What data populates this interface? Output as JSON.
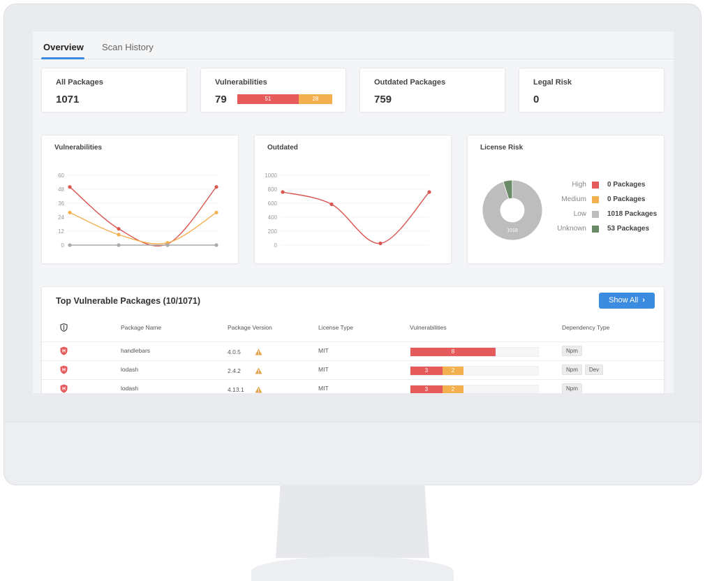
{
  "tabs": [
    {
      "label": "Overview",
      "active": true
    },
    {
      "label": "Scan History",
      "active": false
    }
  ],
  "stats": {
    "all_packages": {
      "label": "All Packages",
      "value": "1071"
    },
    "vulnerabilities": {
      "label": "Vulnerabilities",
      "value": "79",
      "high": 51,
      "medium": 28
    },
    "outdated": {
      "label": "Outdated Packages",
      "value": "759"
    },
    "legal_risk": {
      "label": "Legal Risk",
      "value": "0"
    }
  },
  "colors": {
    "high": "#e55a5a",
    "medium": "#f4b04f",
    "low": "#bdbdbd",
    "unknown": "#6b8a67",
    "accent": "#3b8be0"
  },
  "chart_data": [
    {
      "type": "line",
      "title": "Vulnerabilities",
      "ylim": [
        0,
        60
      ],
      "yticks": [
        0,
        12,
        24,
        36,
        48,
        60
      ],
      "x": [
        0,
        1,
        2,
        3
      ],
      "series": [
        {
          "color": "#d9554f",
          "values": [
            50,
            14,
            1,
            50
          ]
        },
        {
          "color": "#f4b04f",
          "values": [
            28,
            9,
            2,
            28
          ]
        },
        {
          "color": "#aaaaaa",
          "values": [
            0,
            0,
            0,
            0
          ]
        }
      ]
    },
    {
      "type": "line",
      "title": "Outdated",
      "ylim": [
        0,
        1000
      ],
      "yticks": [
        0,
        200,
        400,
        600,
        800,
        1000
      ],
      "x": [
        0,
        1,
        2,
        3
      ],
      "series": [
        {
          "color": "#d9554f",
          "values": [
            760,
            585,
            25,
            760
          ]
        }
      ]
    },
    {
      "type": "pie",
      "title": "License Risk",
      "slices": [
        {
          "label": "High",
          "value": 0,
          "text": "0 Packages",
          "color": "#e55a5a"
        },
        {
          "label": "Medium",
          "value": 0,
          "text": "0 Packages",
          "color": "#f4b04f"
        },
        {
          "label": "Low",
          "value": 1018,
          "text": "1018 Packages",
          "color": "#bdbdbd"
        },
        {
          "label": "Unknown",
          "value": 53,
          "text": "53 Packages",
          "color": "#6b8a67"
        }
      ],
      "center_label": "1018"
    }
  ],
  "table": {
    "title": "Top Vulnerable Packages (10/1071)",
    "show_all_label": "Show All",
    "headers": [
      "Package Name",
      "Package Version",
      "License Type",
      "Vulnerabilities",
      "Dependency Type"
    ],
    "rows": [
      {
        "name": "handlebars",
        "version": "4.0.5",
        "license": "MIT",
        "high": 8,
        "medium": 0,
        "deps": [
          "Npm"
        ]
      },
      {
        "name": "lodash",
        "version": "2.4.2",
        "license": "MIT",
        "high": 3,
        "medium": 2,
        "deps": [
          "Npm",
          "Dev"
        ]
      },
      {
        "name": "lodash",
        "version": "4.13.1",
        "license": "MIT",
        "high": 3,
        "medium": 2,
        "deps": [
          "Npm"
        ]
      }
    ]
  }
}
